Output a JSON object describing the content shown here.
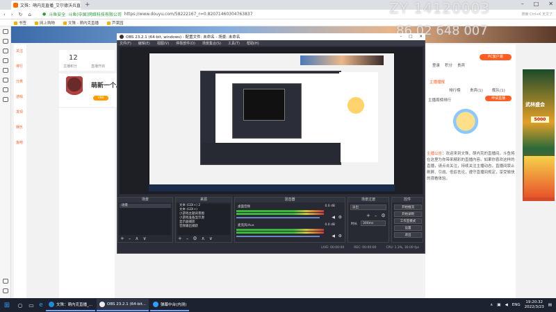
{
  "browser": {
    "tab_title": "文殊：萌内克直播_艾尔德沃兵直播",
    "url_prefix": "斗鱼安全",
    "url_company": "斗鱼(中国)网络科技有限公司",
    "url": "https://www.douyu.com/58222167_r=0.82071460304763837",
    "bookmarks": [
      "书签",
      "网上购物",
      "文殊 - 萌内克直播",
      "芦莱园"
    ],
    "search_placeholder": "搜索 Ctrl+K 天文了",
    "new_tab": "+"
  },
  "overlay": {
    "line1": "ZY 14120003",
    "line2": "86.02 648 007"
  },
  "page": {
    "side_nav": [
      "关注",
      "排行",
      "分类",
      "游戏",
      "发现",
      "娱乐",
      "鱼吧",
      "乐园",
      "赛事"
    ],
    "anchor_count": "12",
    "anchor_label1": "主播积分",
    "anchor_label2": "直播开启",
    "avatar_title": "萌新一个。",
    "vip_badge": "V98",
    "right_links": [
      "登录",
      "积分",
      "贵宾"
    ],
    "pc_button": "PC客户端",
    "tabs": [
      "主播播报",
      "排行榜",
      "贵宾(1)",
      "舰队(1)"
    ],
    "apply_button": "申请直播",
    "rank_label": "主播周榜排行",
    "intro_label": "主播公告",
    "intro_text": "欢迎来到文殊，萌内克的直播间。斗鱼将在这里为你带来精彩的直播内容。如果你喜欢这样的直播，请点击关注，持续关注主播动态，直播间禁止刷屏、引战、低俗言论，遵守直播间规定，享受愉快的观看体验。",
    "ad_price": "5000",
    "ad_title": "武林盛会"
  },
  "obs": {
    "title": "OBS 23.2.1 (64-bit, windows) - 配置文件: 未命名 - 场景: 未命名",
    "menu": [
      "文件(F)",
      "编辑(E)",
      "视图(V)",
      "停靠部件(D)",
      "场景集合(S)",
      "工具(T)",
      "帮助(H)"
    ],
    "docks": {
      "scenes": {
        "title": "场景",
        "items": [
          "场景"
        ]
      },
      "sources": {
        "title": "来源",
        "items": [
          "文本 (GDI+) 2",
          "文本 (GDI+)",
          "小游戏主题背景图",
          "小游戏准备显示源",
          "显示器捕获",
          "音频输出捕获"
        ]
      },
      "mixer": {
        "title": "混音器",
        "ch1": "桌面音频",
        "ch1_db": "0.0 dB",
        "ch2": "麦克风/Aux",
        "ch2_db": "0.0 dB"
      },
      "transitions": {
        "title": "场景过渡",
        "type": "淡出",
        "duration_label": "时长",
        "duration": "300ms"
      },
      "controls": {
        "title": "控件",
        "buttons": [
          "开始推流",
          "开始录制",
          "工作室模式",
          "设置",
          "退出"
        ]
      }
    },
    "status": {
      "live": "LIVE: 00:00:00",
      "rec": "REC: 00:00:00",
      "cpu": "CPU: 1.3%, 30.00 fps"
    }
  },
  "taskbar": {
    "tasks": [
      "文殊：萌内克直播_...",
      "OBS 23.2.1 (64-bit...",
      "弹幕中台(内测)"
    ],
    "lang": "ENG",
    "time": "19:20:32",
    "date": "2022/3/23"
  }
}
